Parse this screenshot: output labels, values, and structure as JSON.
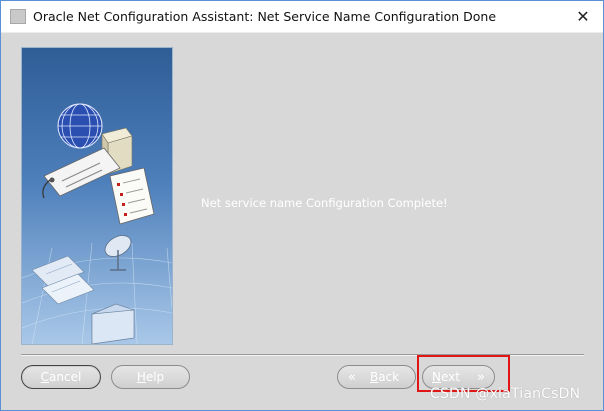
{
  "window": {
    "title": "Oracle Net Configuration Assistant: Net Service Name Configuration Done",
    "close_glyph": "✕"
  },
  "main": {
    "message": "Net service name Configuration Complete!"
  },
  "buttons": {
    "cancel": "Cancel",
    "help": "Help",
    "back": "Back",
    "next": "Next",
    "back_glyph": "«",
    "next_glyph": "»"
  },
  "overlay": {
    "highlight_color": "#e01515",
    "watermark": "CSDN @xiaTianCsDN"
  },
  "icons": {
    "title": "oracle-app-icon",
    "close": "close-icon",
    "side_image": "network-wizard-illustration"
  },
  "colors": {
    "window_bg": "#d8d8d8",
    "border": "#5a8fd6",
    "panel_blue": "#3f6fa8"
  }
}
